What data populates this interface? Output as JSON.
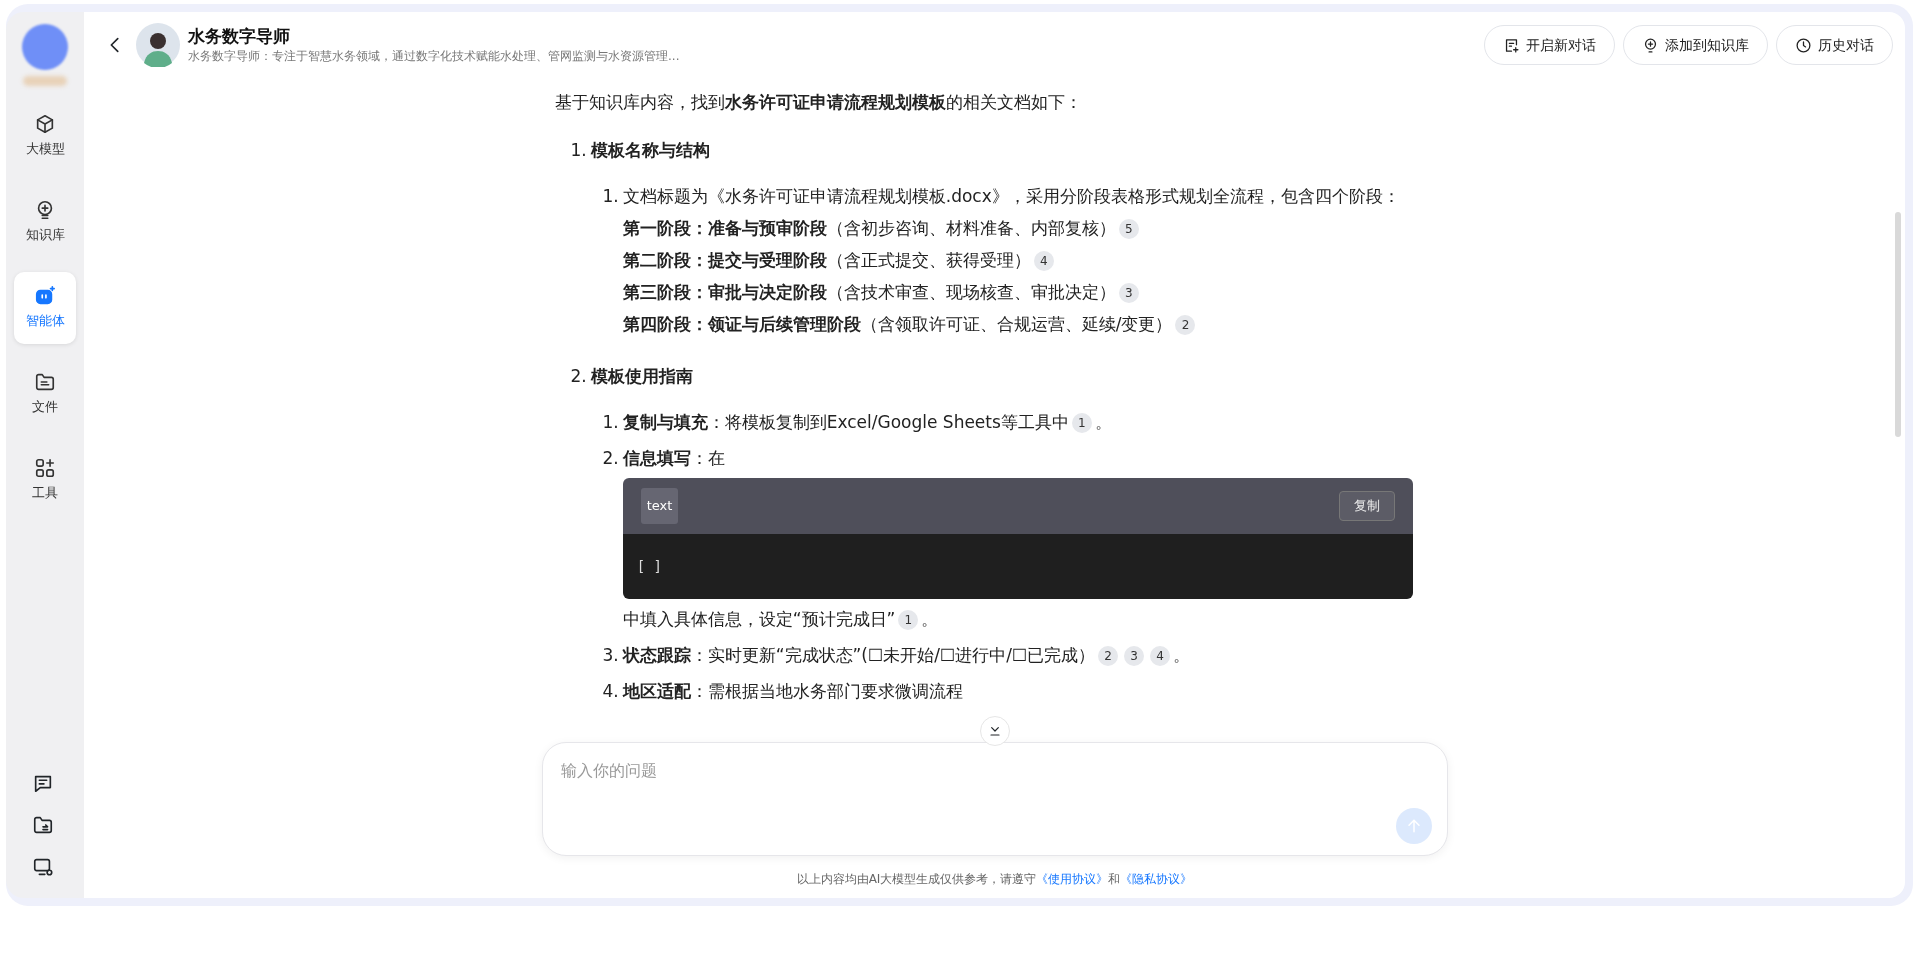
{
  "sidebar": {
    "items": [
      {
        "label": "大模型",
        "selected": false
      },
      {
        "label": "知识库",
        "selected": false
      },
      {
        "label": "智能体",
        "selected": true
      },
      {
        "label": "文件",
        "selected": false
      },
      {
        "label": "工具",
        "selected": false
      }
    ]
  },
  "header": {
    "title": "水务数字导师",
    "subtitle": "水务数字导师：专注于智慧水务领域，通过数字化技术赋能水处理、管网监测与水资源管理...",
    "actions": [
      {
        "label": "开启新对话"
      },
      {
        "label": "添加到知识库"
      },
      {
        "label": "历史对话"
      }
    ]
  },
  "message": {
    "intro": "基于知识库内容，找到**水务许可证申请流程规划模板**的相关文档如下：",
    "sections": [
      {
        "number": "1.",
        "heading": "模板名称与结构",
        "items": [
          {
            "number": "1.",
            "text": "文档标题为《水务许可证申请流程规划模板.docx》，采用分阶段表格形式规划全流程，包含四个阶段：",
            "lines": [
              {
                "text": "**第一阶段：准备与预审阶段**（含初步咨询、材料准备、内部复核）",
                "refs": [
                  "5"
                ]
              },
              {
                "text": "**第二阶段：提交与受理阶段**（含正式提交、获得受理）",
                "refs": [
                  "4"
                ]
              },
              {
                "text": "**第三阶段：审批与决定阶段**（含技术审查、现场核查、审批决定）",
                "refs": [
                  "3"
                ]
              },
              {
                "text": "**第四阶段：领证与后续管理阶段**（含领取许可证、合规运营、延续/变更）",
                "refs": [
                  "2"
                ]
              }
            ]
          }
        ]
      },
      {
        "number": "2.",
        "heading": "模板使用指南",
        "items": [
          {
            "number": "1.",
            "text": "**复制与填充**：将模板复制到Excel/Google Sheets等工具中",
            "refs": [
              "1"
            ],
            "tail": "。"
          },
          {
            "number": "2.",
            "text": "**信息填写**：在",
            "code": {
              "language": "text",
              "copy_label": "复制",
              "content": "[ ]"
            },
            "after": "中填入具体信息，设定“预计完成日”",
            "refs": [
              "1"
            ],
            "tail": "。"
          },
          {
            "number": "3.",
            "text": "**状态跟踪**：实时更新“完成状态”(☐未开始/☐进行中/☐已完成）",
            "refs": [
              "2",
              "3",
              "4"
            ],
            "tail": "。"
          },
          {
            "number": "4.",
            "text": "**地区适配**：需根据当地水务部门要求微调流程"
          }
        ]
      }
    ]
  },
  "composer": {
    "placeholder": "输入你的问题",
    "send_disabled": true
  },
  "footer": {
    "text": "以上内容均由AI大模型生成仅供参考，请遵守",
    "links": [
      "《使用协议》",
      "《隐私协议》"
    ],
    "joiner": "和"
  }
}
